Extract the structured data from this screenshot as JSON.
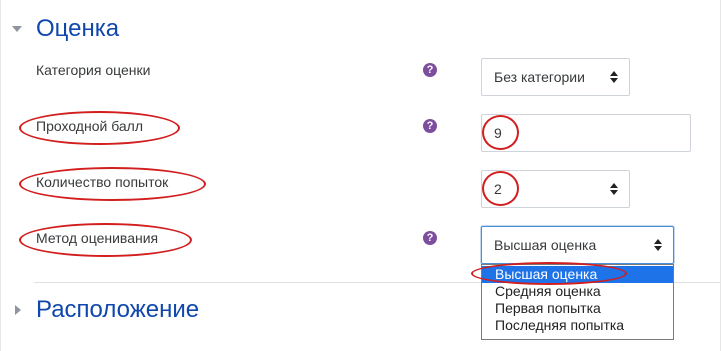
{
  "grade_section": {
    "title": "Оценка",
    "category": {
      "label": "Категория оценки",
      "value": "Без категории",
      "help_icon": "question-circle-icon"
    },
    "pass_grade": {
      "label": "Проходной балл",
      "value": "9",
      "help_icon": "question-circle-icon"
    },
    "attempts": {
      "label": "Количество попыток",
      "value": "2"
    },
    "method": {
      "label": "Метод оценивания",
      "value": "Высшая оценка",
      "help_icon": "question-circle-icon",
      "options": [
        "Высшая оценка",
        "Средняя оценка",
        "Первая попытка",
        "Последняя попытка"
      ],
      "selected_option": "Высшая оценка"
    }
  },
  "layout_section": {
    "title": "Расположение"
  },
  "colors": {
    "accent": "#0f47ad",
    "help": "#7d4e9e",
    "annotation": "#d21e1e",
    "selected": "#1e73e8"
  }
}
